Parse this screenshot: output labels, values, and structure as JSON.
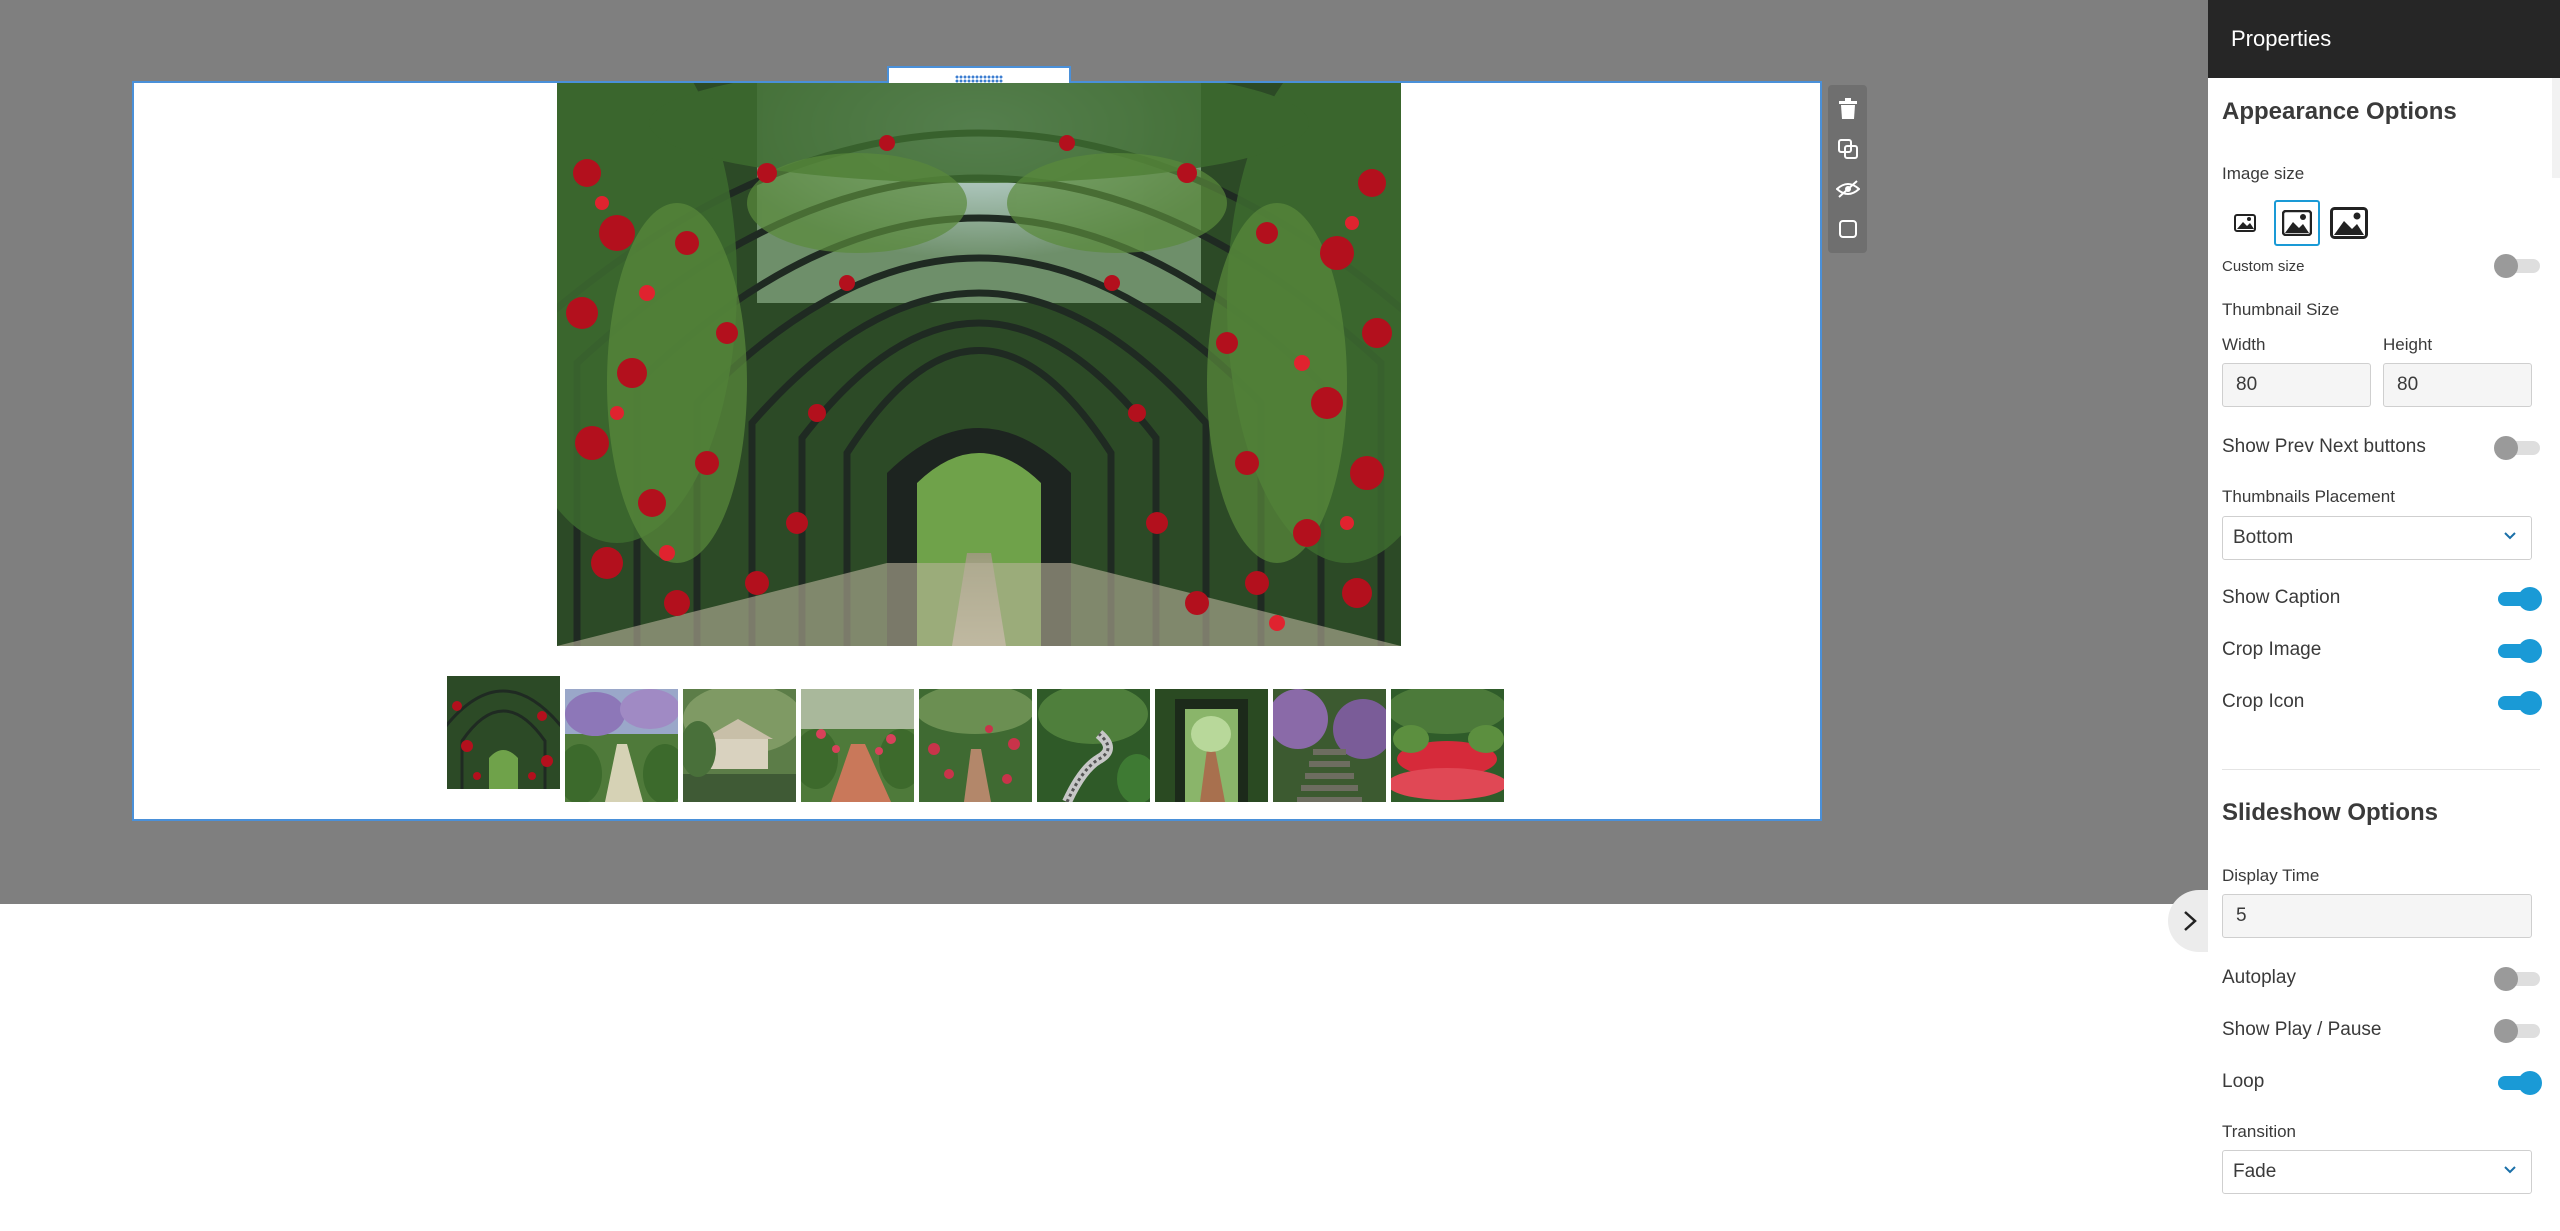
{
  "canvas": {
    "background": "#7f7f7f",
    "selection_color": "#4a90d9",
    "thumbnail_count": 9,
    "active_thumbnail": 0
  },
  "toolbar": {
    "tools": [
      "trash-icon",
      "duplicate-icon",
      "hide-icon",
      "square-icon"
    ]
  },
  "panel": {
    "title": "Properties",
    "appearance": {
      "heading": "Appearance Options",
      "image_size_label": "Image size",
      "image_size_selected": "medium",
      "custom_size_label": "Custom size",
      "custom_size_on": false,
      "thumbnail_size_label": "Thumbnail Size",
      "width_label": "Width",
      "width_value": "80",
      "height_label": "Height",
      "height_value": "80",
      "prev_next_label": "Show Prev Next buttons",
      "prev_next_on": false,
      "placement_label": "Thumbnails Placement",
      "placement_value": "Bottom",
      "show_caption_label": "Show Caption",
      "show_caption_on": true,
      "crop_image_label": "Crop Image",
      "crop_image_on": true,
      "crop_icon_label": "Crop Icon",
      "crop_icon_on": true
    },
    "slideshow": {
      "heading": "Slideshow Options",
      "display_time_label": "Display Time",
      "display_time_value": "5",
      "autoplay_label": "Autoplay",
      "autoplay_on": false,
      "play_pause_label": "Show Play / Pause",
      "play_pause_on": false,
      "loop_label": "Loop",
      "loop_on": true,
      "transition_label": "Transition",
      "transition_value": "Fade"
    },
    "accent_color": "#1a9ad6"
  }
}
